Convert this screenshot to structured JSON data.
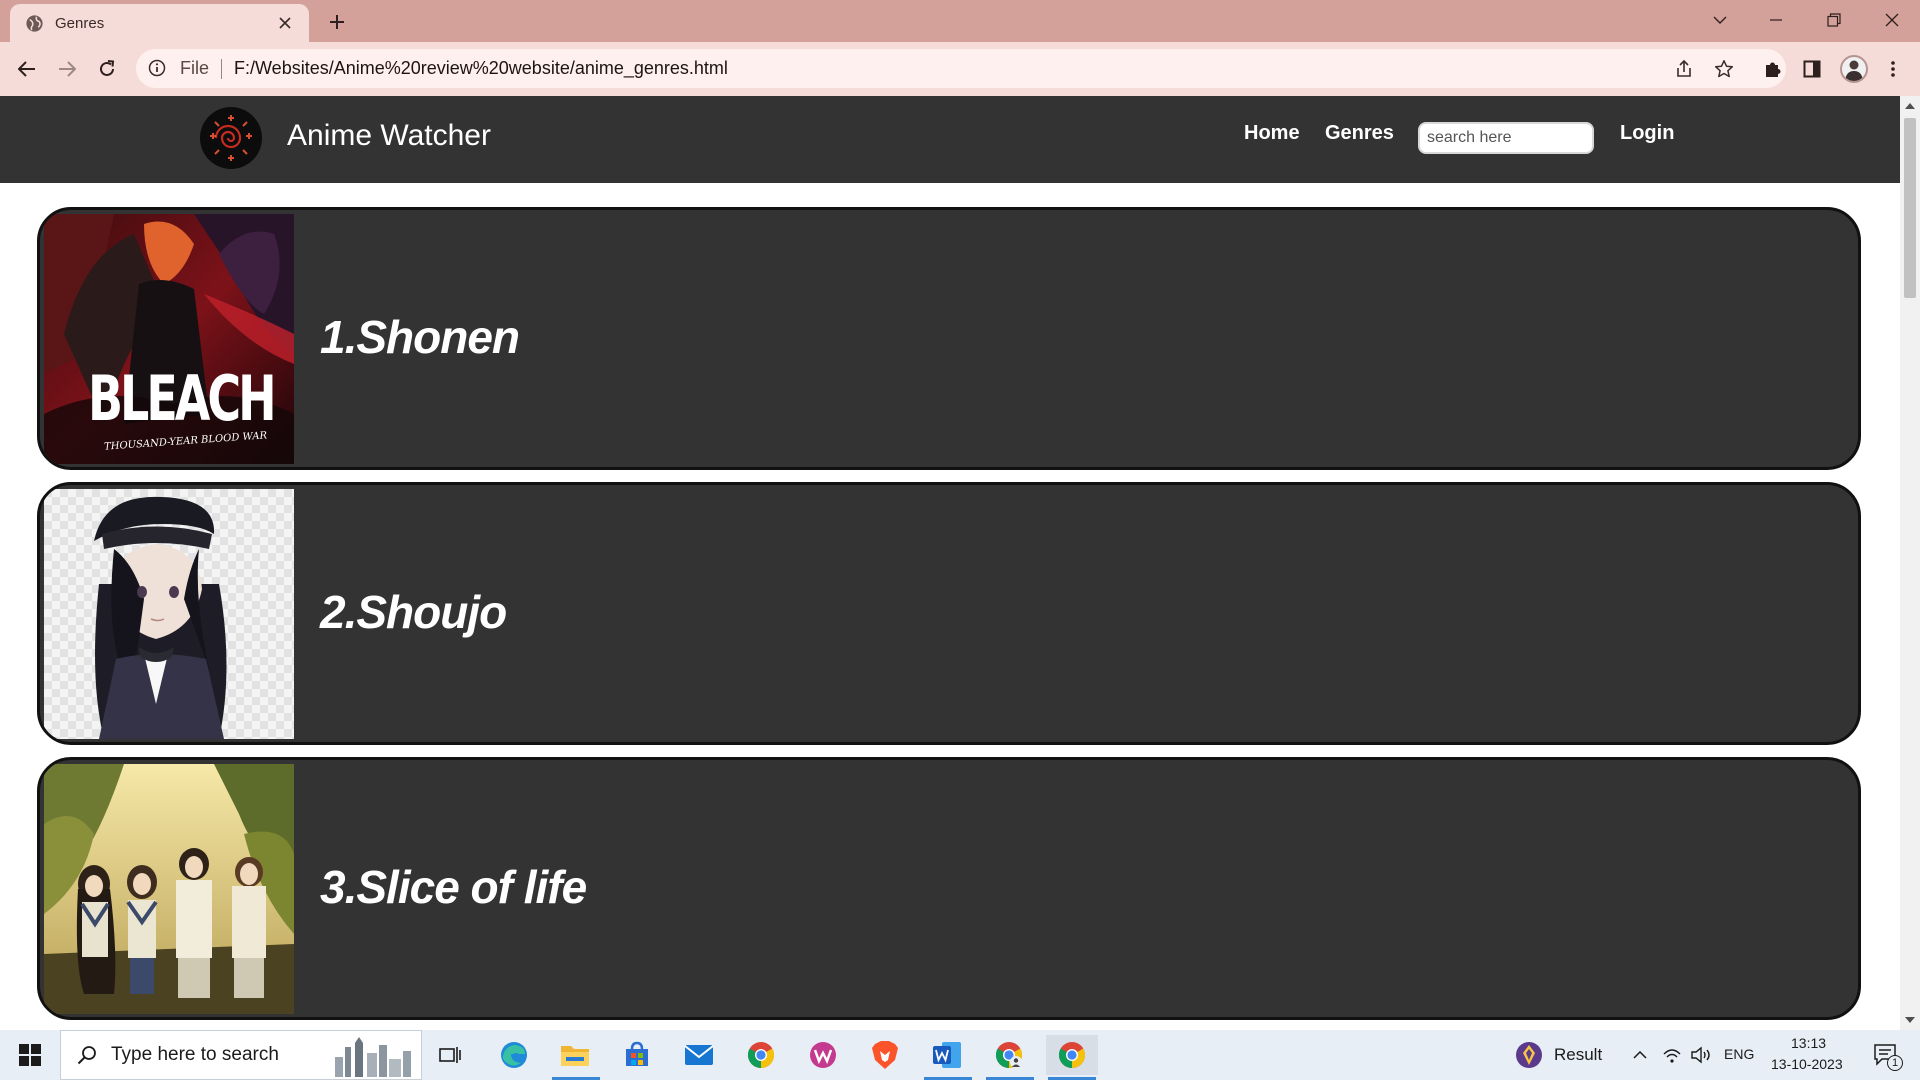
{
  "browser": {
    "tab_title": "Genres",
    "omnibox_scheme": "File",
    "url": "F:/Websites/Anime%20review%20website/anime_genres.html"
  },
  "site": {
    "brand": "Anime Watcher",
    "nav": {
      "home": "Home",
      "genres": "Genres",
      "login": "Login"
    },
    "search": {
      "placeholder": "search here",
      "value": ""
    }
  },
  "genres": [
    {
      "title": "1.Shonen",
      "image_text": "BLEACH",
      "image_subtext": "THOUSAND-YEAR BLOOD WAR"
    },
    {
      "title": "2.Shoujo"
    },
    {
      "title": "3.Slice of life"
    }
  ],
  "taskbar": {
    "search_placeholder": "Type here to search",
    "weather_label": "Result",
    "language": "ENG",
    "time": "13:13",
    "date": "13-10-2023",
    "notification_count": "1"
  },
  "colors": {
    "tabstrip": "#d4a19a",
    "toolbar": "#f6dcd8",
    "site_header": "#333333",
    "card_background": "#333333",
    "card_border": "#111111"
  }
}
